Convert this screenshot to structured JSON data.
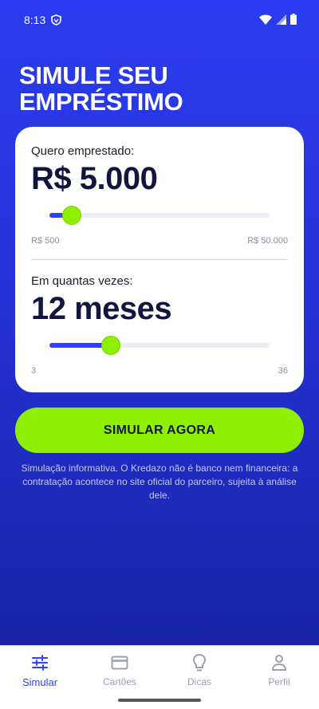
{
  "status": {
    "time": "8:13"
  },
  "header": {
    "title": "SIMULE SEU EMPRÉSTIMO"
  },
  "amount": {
    "label": "Quero emprestado:",
    "value": "R$ 5.000",
    "min": "R$ 500",
    "max": "R$ 50.000",
    "fraction": 0.1
  },
  "term": {
    "label": "Em quantas vezes:",
    "value": "12 meses",
    "min": "3",
    "max": "36",
    "fraction": 0.28
  },
  "cta": {
    "label": "SIMULAR AGORA"
  },
  "disclaimer": "Simulação informativa. O Kredazo não é banco nem financeira: a contratação acontece no site oficial do parceiro, sujeita à análise dele.",
  "nav": {
    "items": [
      {
        "label": "Simular",
        "icon": "sliders-icon",
        "active": true
      },
      {
        "label": "Cartões",
        "icon": "card-icon",
        "active": false
      },
      {
        "label": "Dicas",
        "icon": "lightbulb-icon",
        "active": false
      },
      {
        "label": "Perfil",
        "icon": "person-icon",
        "active": false
      }
    ]
  },
  "colors": {
    "accent": "#8ef000",
    "primary": "#2f43f2",
    "background": "#2333d6"
  }
}
